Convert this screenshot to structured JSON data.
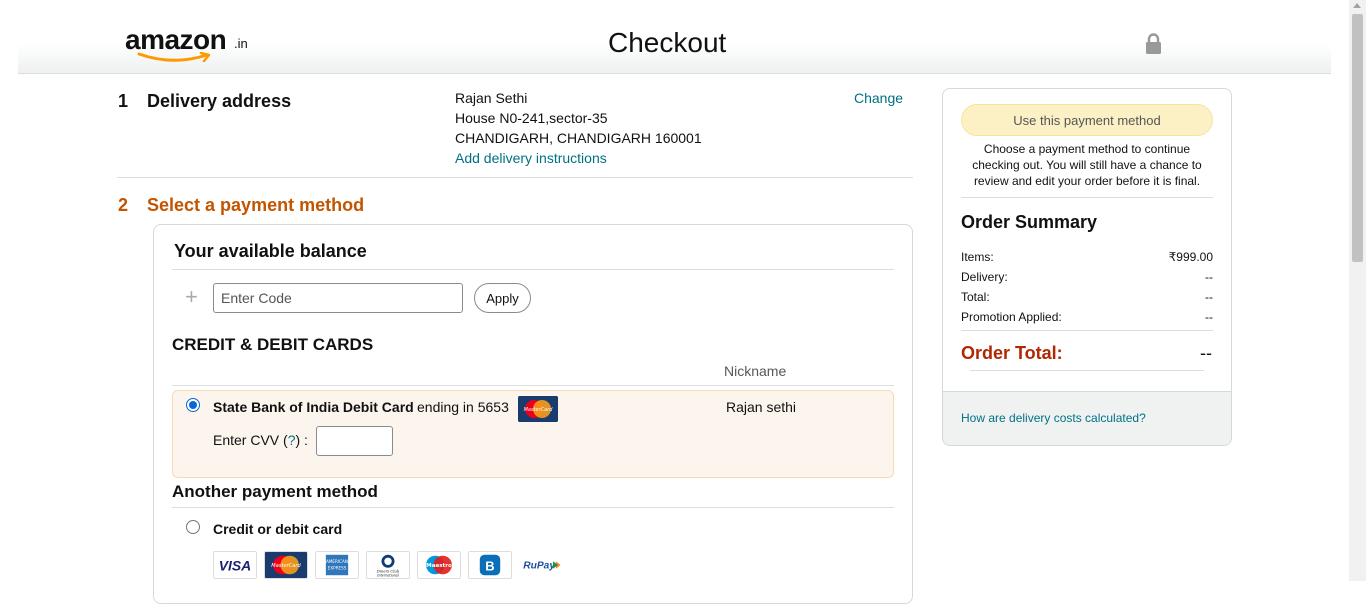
{
  "header": {
    "logo_text": "amazon",
    "logo_suffix": ".in",
    "title": "Checkout"
  },
  "delivery": {
    "number": "1",
    "title": "Delivery address",
    "name": "Rajan Sethi",
    "line1": "House N0-241,sector-35",
    "line2": "CHANDIGARH, CHANDIGARH 160001",
    "instructions_link": "Add delivery instructions",
    "change_link": "Change"
  },
  "payment": {
    "number": "2",
    "title": "Select a payment method",
    "balance_title": "Your available balance",
    "code_placeholder": "Enter Code",
    "apply_label": "Apply",
    "cards_title": "CREDIT & DEBIT CARDS",
    "nickname_header": "Nickname",
    "saved_card": {
      "bank": "State Bank of India Debit Card",
      "ending": "ending in 5653",
      "nickname": "Rajan sethi",
      "cvv_label": "Enter CVV",
      "cvv_help": "?",
      "selected": true
    },
    "another_title": "Another payment method",
    "credit_debit_label": "Credit or debit card",
    "brands": [
      "VISA",
      "MasterCard",
      "American Express",
      "Diners Club International",
      "Maestro",
      "Bajaj Finserv",
      "RuPay"
    ]
  },
  "summary": {
    "use_button": "Use this payment method",
    "note": "Choose a payment method to continue checking out. You will still have a chance to review and edit your order before it is final.",
    "title": "Order Summary",
    "rows": [
      {
        "label": "Items:",
        "value": "₹999.00"
      },
      {
        "label": "Delivery:",
        "value": "--"
      },
      {
        "label": "Total:",
        "value": "--"
      },
      {
        "label": "Promotion Applied:",
        "value": "--"
      }
    ],
    "order_total_label": "Order Total:",
    "order_total_value": "--",
    "delivery_costs_link": "How are delivery costs calculated?"
  },
  "colors": {
    "link": "#007185",
    "section_orange": "#c45500",
    "order_total_red": "#b12704",
    "selected_row_bg": "#fcf5ee",
    "use_button_bg": "#fcf1c5"
  }
}
